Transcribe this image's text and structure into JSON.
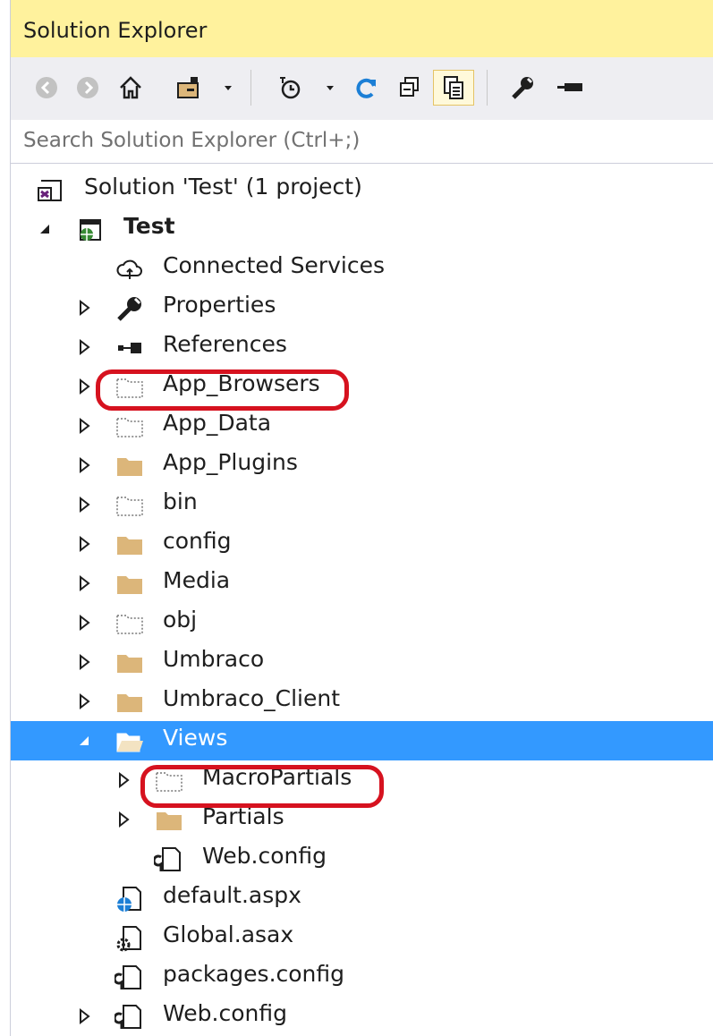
{
  "window": {
    "title": "Solution Explorer"
  },
  "toolbar": {
    "buttons": [
      {
        "name": "back-icon"
      },
      {
        "name": "forward-icon"
      },
      {
        "name": "home-icon"
      },
      {
        "name": "switch-views-icon"
      },
      {
        "name": "dropdown-icon"
      },
      {
        "name": "pending-changes-filter-icon"
      },
      {
        "name": "dropdown-icon"
      },
      {
        "name": "refresh-icon"
      },
      {
        "name": "collapse-all-icon"
      },
      {
        "name": "show-all-files-icon",
        "active": true
      },
      {
        "name": "properties-icon"
      },
      {
        "name": "preview-icon"
      }
    ]
  },
  "search": {
    "placeholder": "Search Solution Explorer (Ctrl+;)"
  },
  "tree": {
    "items": [
      {
        "label": "Solution 'Test' (1 project)",
        "icon": "solution-icon",
        "expander": "none"
      },
      {
        "label": "Test",
        "icon": "web-project-icon",
        "expander": "expanded",
        "bold": true
      },
      {
        "label": "Connected Services",
        "icon": "cloud-icon",
        "expander": "none"
      },
      {
        "label": "Properties",
        "icon": "wrench-icon",
        "expander": "collapsed"
      },
      {
        "label": "References",
        "icon": "references-icon",
        "expander": "collapsed"
      },
      {
        "label": "App_Browsers",
        "icon": "hidden-folder-icon",
        "expander": "collapsed",
        "highlighted": true
      },
      {
        "label": "App_Data",
        "icon": "hidden-folder-icon",
        "expander": "collapsed"
      },
      {
        "label": "App_Plugins",
        "icon": "folder-icon",
        "expander": "collapsed"
      },
      {
        "label": "bin",
        "icon": "hidden-folder-icon",
        "expander": "collapsed"
      },
      {
        "label": "config",
        "icon": "folder-icon",
        "expander": "collapsed"
      },
      {
        "label": "Media",
        "icon": "folder-icon",
        "expander": "collapsed"
      },
      {
        "label": "obj",
        "icon": "hidden-folder-icon",
        "expander": "collapsed"
      },
      {
        "label": "Umbraco",
        "icon": "folder-icon",
        "expander": "collapsed"
      },
      {
        "label": "Umbraco_Client",
        "icon": "folder-icon",
        "expander": "collapsed"
      },
      {
        "label": "Views",
        "icon": "open-folder-icon",
        "expander": "expanded",
        "selected": true
      },
      {
        "label": "MacroPartials",
        "icon": "hidden-folder-icon",
        "expander": "collapsed",
        "highlighted": true
      },
      {
        "label": "Partials",
        "icon": "folder-icon",
        "expander": "collapsed"
      },
      {
        "label": "Web.config",
        "icon": "config-file-icon",
        "expander": "none"
      },
      {
        "label": "default.aspx",
        "icon": "aspx-file-icon",
        "expander": "none"
      },
      {
        "label": "Global.asax",
        "icon": "asax-file-icon",
        "expander": "none"
      },
      {
        "label": "packages.config",
        "icon": "config-file-icon",
        "expander": "none"
      },
      {
        "label": "Web.config",
        "icon": "config-file-icon",
        "expander": "collapsed"
      }
    ]
  }
}
